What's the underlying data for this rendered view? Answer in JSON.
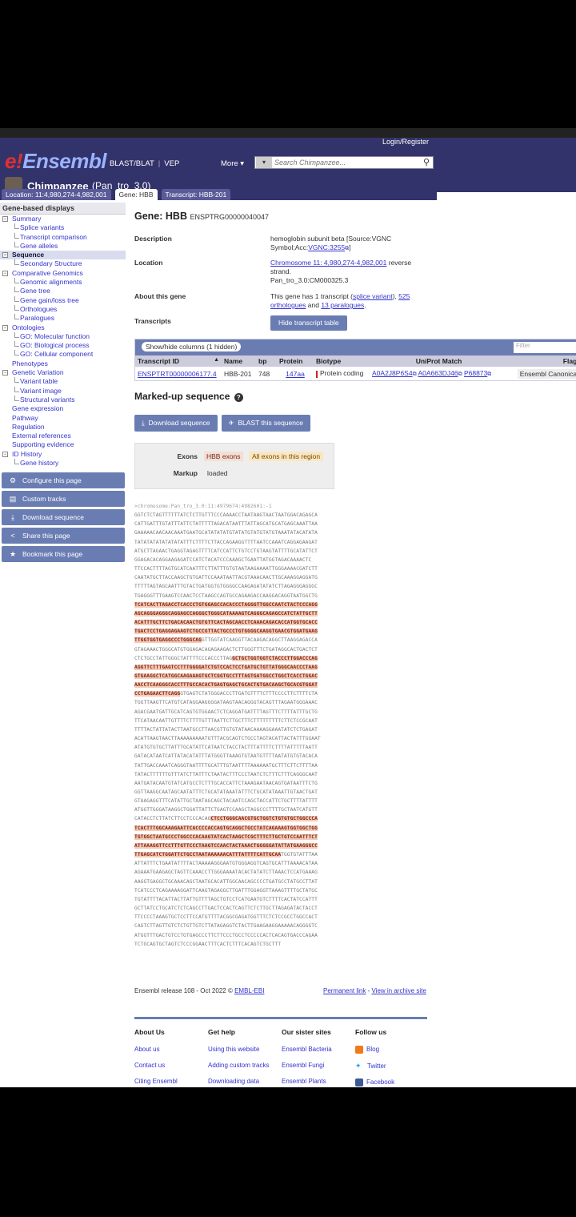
{
  "header": {
    "login": "Login/Register",
    "logo_e": "e!",
    "logo_text": "Ensembl",
    "blast": "BLAST/BLAT",
    "vep": "VEP",
    "more": "More ▾",
    "search_placeholder": "Search Chimpanzee...",
    "species_name": "Chimpanzee",
    "assembly": "(Pan_tro_3.0)"
  },
  "tabs": [
    {
      "label": "Location: 11:4,980,274-4,982,001"
    },
    {
      "label": "Gene: HBB"
    },
    {
      "label": "Transcript: HBB-201"
    }
  ],
  "sidebar": {
    "title": "Gene-based displays",
    "items": [
      {
        "label": "Summary",
        "level": 0,
        "box": "⊟"
      },
      {
        "label": "Splice variants",
        "level": 1
      },
      {
        "label": "Transcript comparison",
        "level": 1
      },
      {
        "label": "Gene alleles",
        "level": 1
      },
      {
        "label": "Sequence",
        "level": 0,
        "box": "⊟"
      },
      {
        "label": "Secondary Structure",
        "level": 1
      },
      {
        "label": "Comparative Genomics",
        "level": 0,
        "box": "⊟"
      },
      {
        "label": "Genomic alignments",
        "level": 1
      },
      {
        "label": "Gene tree",
        "level": 1
      },
      {
        "label": "Gene gain/loss tree",
        "level": 1
      },
      {
        "label": "Orthologues",
        "level": 1
      },
      {
        "label": "Paralogues",
        "level": 1
      },
      {
        "label": "Ontologies",
        "level": 0,
        "box": "⊟"
      },
      {
        "label": "GO: Molecular function",
        "level": 1
      },
      {
        "label": "GO: Biological process",
        "level": 1
      },
      {
        "label": "GO: Cellular component",
        "level": 1
      },
      {
        "label": "Phenotypes",
        "level": 0
      },
      {
        "label": "Genetic Variation",
        "level": 0,
        "box": "⊟"
      },
      {
        "label": "Variant table",
        "level": 1
      },
      {
        "label": "Variant image",
        "level": 1
      },
      {
        "label": "Structural variants",
        "level": 1
      },
      {
        "label": "Gene expression",
        "level": 0
      },
      {
        "label": "Pathway",
        "level": 0
      },
      {
        "label": "Regulation",
        "level": 0
      },
      {
        "label": "External references",
        "level": 0
      },
      {
        "label": "Supporting evidence",
        "level": 0
      },
      {
        "label": "ID History",
        "level": 0,
        "box": "⊟"
      },
      {
        "label": "Gene history",
        "level": 1
      }
    ],
    "buttons": [
      {
        "label": "Configure this page",
        "icon": "⚙"
      },
      {
        "label": "Custom tracks",
        "icon": "▤"
      },
      {
        "label": "Download sequence",
        "icon": "⤓"
      },
      {
        "label": "Share this page",
        "icon": "<"
      },
      {
        "label": "Bookmark this page",
        "icon": "★"
      }
    ]
  },
  "gene": {
    "title": "Gene: HBB",
    "stable_id": "ENSPTRG00000040047",
    "description_label": "Description",
    "description_1": "hemoglobin subunit beta [Source:VGNC",
    "description_2": "Symbol;Acc:",
    "description_acc": "VGNC:3255",
    "description_end": "]",
    "location_label": "Location",
    "location_link": "Chromosome 11: 4,980,274-4,982,001",
    "location_strand": " reverse",
    "location_strand2": "strand.",
    "location_assembly": "Pan_tro_3.0:CM000325.3",
    "about_label": "About this gene",
    "about_1": "This gene has 1 transcript (",
    "about_splice": "splice variant",
    "about_2": "), ",
    "about_orth_count": "525",
    "about_orth": "orthologues",
    "about_3": " and ",
    "about_para": "13 paralogues",
    "about_4": ".",
    "transcripts_label": "Transcripts",
    "hide_button": "Hide transcript table"
  },
  "tx_table": {
    "show_hide": "Show/hide columns (1 hidden)",
    "filter_placeholder": "Filter",
    "headers": [
      "Transcript ID",
      "Name",
      "bp",
      "Protein",
      "Biotype",
      "UniProt Match",
      "Flags"
    ],
    "row": {
      "id": "ENSPTRT00000006177.4",
      "name": "HBB-201",
      "bp": "748",
      "protein": "147aa",
      "biotype": "Protein coding",
      "uniprot_1": "A0A2J8P6S4",
      "uniprot_2": "A0A663DJ46",
      "uniprot_3": "P68873",
      "flags": "Ensembl Canonical"
    }
  },
  "markup": {
    "title": "Marked-up sequence",
    "download": "Download sequence",
    "blast": "BLAST this sequence",
    "exons_label": "Exons",
    "hbb_exons": "HBB exons",
    "all_exons": "All exons in this region",
    "markup_label": "Markup",
    "markup_value": "loaded"
  },
  "sequence": {
    "header": ">chromosome:Pan_tro_3.0:11:4979674:4982601:-1",
    "lines": [
      [
        [
          "n",
          "GGTCTCTAGTTTTTTATCTCTTGTTTCCCAAAACCTAATAAGTAACTAATGGACAGAGCA"
        ]
      ],
      [
        [
          "n",
          "CATTGATTTGTATTTATTCTATTTTTAGACATAATTTATTAGCATGCATGAGCAAATTAA"
        ]
      ],
      [
        [
          "n",
          "GAAAAACAACAACAAATGAATGCATATATATGTATATGTATGTATGTAAATATACATATA"
        ]
      ],
      [
        [
          "n",
          "TATATATATATATATATTTCTTTTCTTACCAGAAGGTTTTAATCCAAATCAGGAGAAGAT"
        ]
      ],
      [
        [
          "n",
          "ATGCTTAGAACTGAGGTAGAGTTTTCATCCATTCTGTCCTGTAAGTATTTTGCATATTCT"
        ]
      ],
      [
        [
          "n",
          "GGAGACACAGGAAGAGATCCATCTACATCCCAAAGCTGAATTATGGTAGACAAAACTC"
        ]
      ],
      [
        [
          "n",
          "TTCCACTTTTAGTGCATCAATTTCTTATTTGTGTAATAAGAAAATTGGGAAAACGATCTT"
        ]
      ],
      [
        [
          "n",
          "CAATATGCTTACCAAGCTGTGATTCCAAATAATTACGTAAACAACTTGCAAAGGAGGATG"
        ]
      ],
      [
        [
          "n",
          "TTTTTAGTAGCAATTTGTACTGATGGTGTGGGGCCAAGAGATATATCTTAGAGGGAGGGC"
        ]
      ],
      [
        [
          "n",
          "TGAGGGTTTGAAGTCCAACTCCTAAGCCAGTGCCAGAAGACCAAGGACAGGTAATGGCTG"
        ]
      ],
      [
        [
          "e",
          "TCATCACTTAGACCTCACCCTGTGGAGCCACACCCTAGGGTTGGCCAATCTACTCCCAGG"
        ]
      ],
      [
        [
          "e",
          "AGCAGGGAGGGCAGGAGCCAGGGCTGGGCATAAAAGTCAGGGCAGAGCCATCTATTGCTT"
        ]
      ],
      [
        [
          "e",
          "ACATTTGCTTCTGACACAACTGTGTTCACTAGCAACCTCAAACAGACACCATGGTGCACC"
        ]
      ],
      [
        [
          "e",
          "TGACTCCTGAGGAGAAGTCTGCCGTTACTGCCCTGTGGGGCAAGGTGAACGTGGATGAAG"
        ]
      ],
      [
        [
          "e",
          "TTGGTGGTGAGGCCCTGGGCAG"
        ],
        [
          "n",
          "GTTGGTATCAAGGTTACAAGACAGGCTTAAGGAGACCA"
        ]
      ],
      [
        [
          "n",
          "GTAGAAACTGGGCATGTGGAGACAGAGAAGACTCTTGGGTTTCTGATAGGCACTGACTCT"
        ]
      ],
      [
        [
          "n",
          "CTCTGCCTATTGGGCTATTTTCCCACCCTTAG"
        ],
        [
          "e",
          "GCTGCTGGTGGTCTACCCTTGGACCCAG"
        ]
      ],
      [
        [
          "e",
          "AGGTTCTTTGAGTCCTTTGGGGATCTGTCCACTCCTGATGCTGTTATGGGCAACCCTAAG"
        ]
      ],
      [
        [
          "e",
          "GTGAAGGCTCATGGCAAGAAAGTGCTCGGTGCCTTTAGTGATGGCCTGGCTCACCTGGAC"
        ]
      ],
      [
        [
          "e",
          "AACCTCAAGGGCACCTTTGCCACACTGAGTGAGCTGCACTGTGACAAGCTGCACGTGGAT"
        ]
      ],
      [
        [
          "e",
          "CCTGAGAACTTCAGG"
        ],
        [
          "n",
          "GTGAGTCTATGGGACCCTTGATGTTTTCTTTCCCCTTCTTTTCTA"
        ]
      ],
      [
        [
          "n",
          "TGGTTAAGTTCATGTCATAGGAAGGGGATAAGTAACAGGGTACAGTTTAGAATGGGAAAC"
        ]
      ],
      [
        [
          "n",
          "AGACGAATGATTGCATCAGTGTGGAACTCTCAGGATGATTTTAGTTTCTTTTATTTGCTG"
        ]
      ],
      [
        [
          "n",
          "TTCATAACAATTGTTTTCTTTTGTTTAATTCTTGCTTTCTTTTTTTTTCTTCTCCGCAAT"
        ]
      ],
      [
        [
          "n",
          "TTTTACTATTATACTTAATGCCTTAACGTTGTGTATAACAAAAGGAAATATCTCTGAGAT"
        ]
      ],
      [
        [
          "n",
          "ACATTAAGTAACTTAAAAAAAAATGTTTACGCAGTCTGCCTAGTACATTACTATTTGGAAT"
        ]
      ],
      [
        [
          "n",
          "ATATGTGTGCTTATTTGCATATTCATAATCTACCTACTTTATTTTCTTTTATTTTTAATT"
        ]
      ],
      [
        [
          "n",
          "GATACATAATCATTATACATATTTATGGGTTAAAGTGTAATGTTTTAATATGTGTACACA"
        ]
      ],
      [
        [
          "n",
          "TATTGACCAAATCAGGGTAATTTTGCATTTGTAATTTTAAAAAATGCTTTCTTCTTTTAA"
        ]
      ],
      [
        [
          "n",
          "TATACTTTTTTGTTTATCTTATTTCTAATACTTTCCCTAATCTCTTTCTTTCAGGGCAAT"
        ]
      ],
      [
        [
          "n",
          "AATGATACAATGTATCATGCCTCTTTGCACCATTCTAAAGAATAACAGTGATAATTTCTG"
        ]
      ],
      [
        [
          "n",
          "GGTTAAGGCAATAGCAATATTTCTGCATATAAATATTTCTGCATATAAATTGTAACTGAT"
        ]
      ],
      [
        [
          "n",
          "GTAAGAGGTTTCATATTGCTAATAGCAGCTACAATCCAGCTACCATTCTGCTTTTATTTT"
        ]
      ],
      [
        [
          "n",
          "ATGGTTGGGATAAGGCTGGATTATTCTGAGTCCAAGCTAGGCCCTTTTGCTAATCATGTT"
        ]
      ],
      [
        [
          "n",
          "CATACCTCTTATCTTCCTCCCACAG"
        ],
        [
          "e",
          "CTCCTGGGCAACGTGCTGGTCTGTGTGCTGGCCCA"
        ]
      ],
      [
        [
          "e",
          "TCACTTTGGCAAAGAATTCACCCCACCAGTGCAGGCTGCCTATCAGAAAGTGGTGGCTGG"
        ]
      ],
      [
        [
          "e",
          "TGTGGCTAATGCCCTGGCCCACAAGTATCACTAAGCTCGCTTTCTTGCTGTCCAATTTCT"
        ]
      ],
      [
        [
          "e",
          "ATTAAAGGTTCCTTTGTTCCCTAAGTCCAACTACTAAACTGGGGGATATTATGAAGGGCC"
        ]
      ],
      [
        [
          "e",
          "TTGAGCATCTGGATTCTGCCTAATAAAAAACATTTATTTTCATTGCAA"
        ],
        [
          "n",
          "TGGTGTATTTAA"
        ]
      ],
      [
        [
          "n",
          "ATTATTTCTGAATATTTTACTAAAAAGGGAATGTGGGAGGTCAGTGCATTTAAAACATAA"
        ]
      ],
      [
        [
          "n",
          "AGAAATGAAGAGCTAGTTCAAACCTTGGGAAAATACACTATATCTTAAACTCCATGAAAG"
        ]
      ],
      [
        [
          "n",
          "AAGGTGAGGCTGCAAACAGCTAATGCACATTGGCAACAGCCCCTGATGCCTATGCCTTAT"
        ]
      ],
      [
        [
          "n",
          "TCATCCCTCAGAAAAGGATTCAAGTAGAGGCTTGATTTGGAGGTTAAAGTTTTGCTATGC"
        ]
      ],
      [
        [
          "n",
          "TGTATTTTACATTACTTATTGTTTTAGCTGTCCTCATGAATGTCTTTTCACTATCCATTT"
        ]
      ],
      [
        [
          "n",
          "GCTTATCCTGCATCTCTCAGCCTTGACTCCACTCAGTTCTCTTGCTTAGAGATACTACCT"
        ]
      ],
      [
        [
          "n",
          "TTCCCCTAAAGTGCTCCTTCCATGTTTTACGGCGAGATGGTTTCTCTCCGCCTGGCCACT"
        ]
      ],
      [
        [
          "n",
          "CAGTCTTAGTTGTCTCTGTTGTCTTATAGAGGTCTACTTGAAGAAGGAAAAACAGGGGTC"
        ]
      ],
      [
        [
          "n",
          "ATGGTTTGACTGTCCTGTGAGCCCTTCTTCCCTGCCTCCCCCACTCACAGTGACCCAGAA"
        ]
      ],
      [
        [
          "n",
          "TCTGCAGTGCTAGTCTCCCGGAACTTTCACTCTTTCACAGTCTGCTTT"
        ]
      ]
    ]
  },
  "footer": {
    "release": "Ensembl release 108 - Oct 2022 © ",
    "ebi": "EMBL-EBI",
    "permanent": "Permanent link",
    "sep": " - ",
    "archive": "View in archive site",
    "cols": [
      {
        "title": "About Us",
        "links": [
          "About us",
          "Contact us",
          "Citing Ensembl"
        ]
      },
      {
        "title": "Get help",
        "links": [
          "Using this website",
          "Adding custom tracks",
          "Downloading data"
        ]
      },
      {
        "title": "Our sister sites",
        "links": [
          "Ensembl Bacteria",
          "Ensembl Fungi",
          "Ensembl Plants"
        ]
      },
      {
        "title": "Follow us",
        "links": [
          "Blog",
          "Twitter",
          "Facebook"
        ]
      }
    ]
  }
}
